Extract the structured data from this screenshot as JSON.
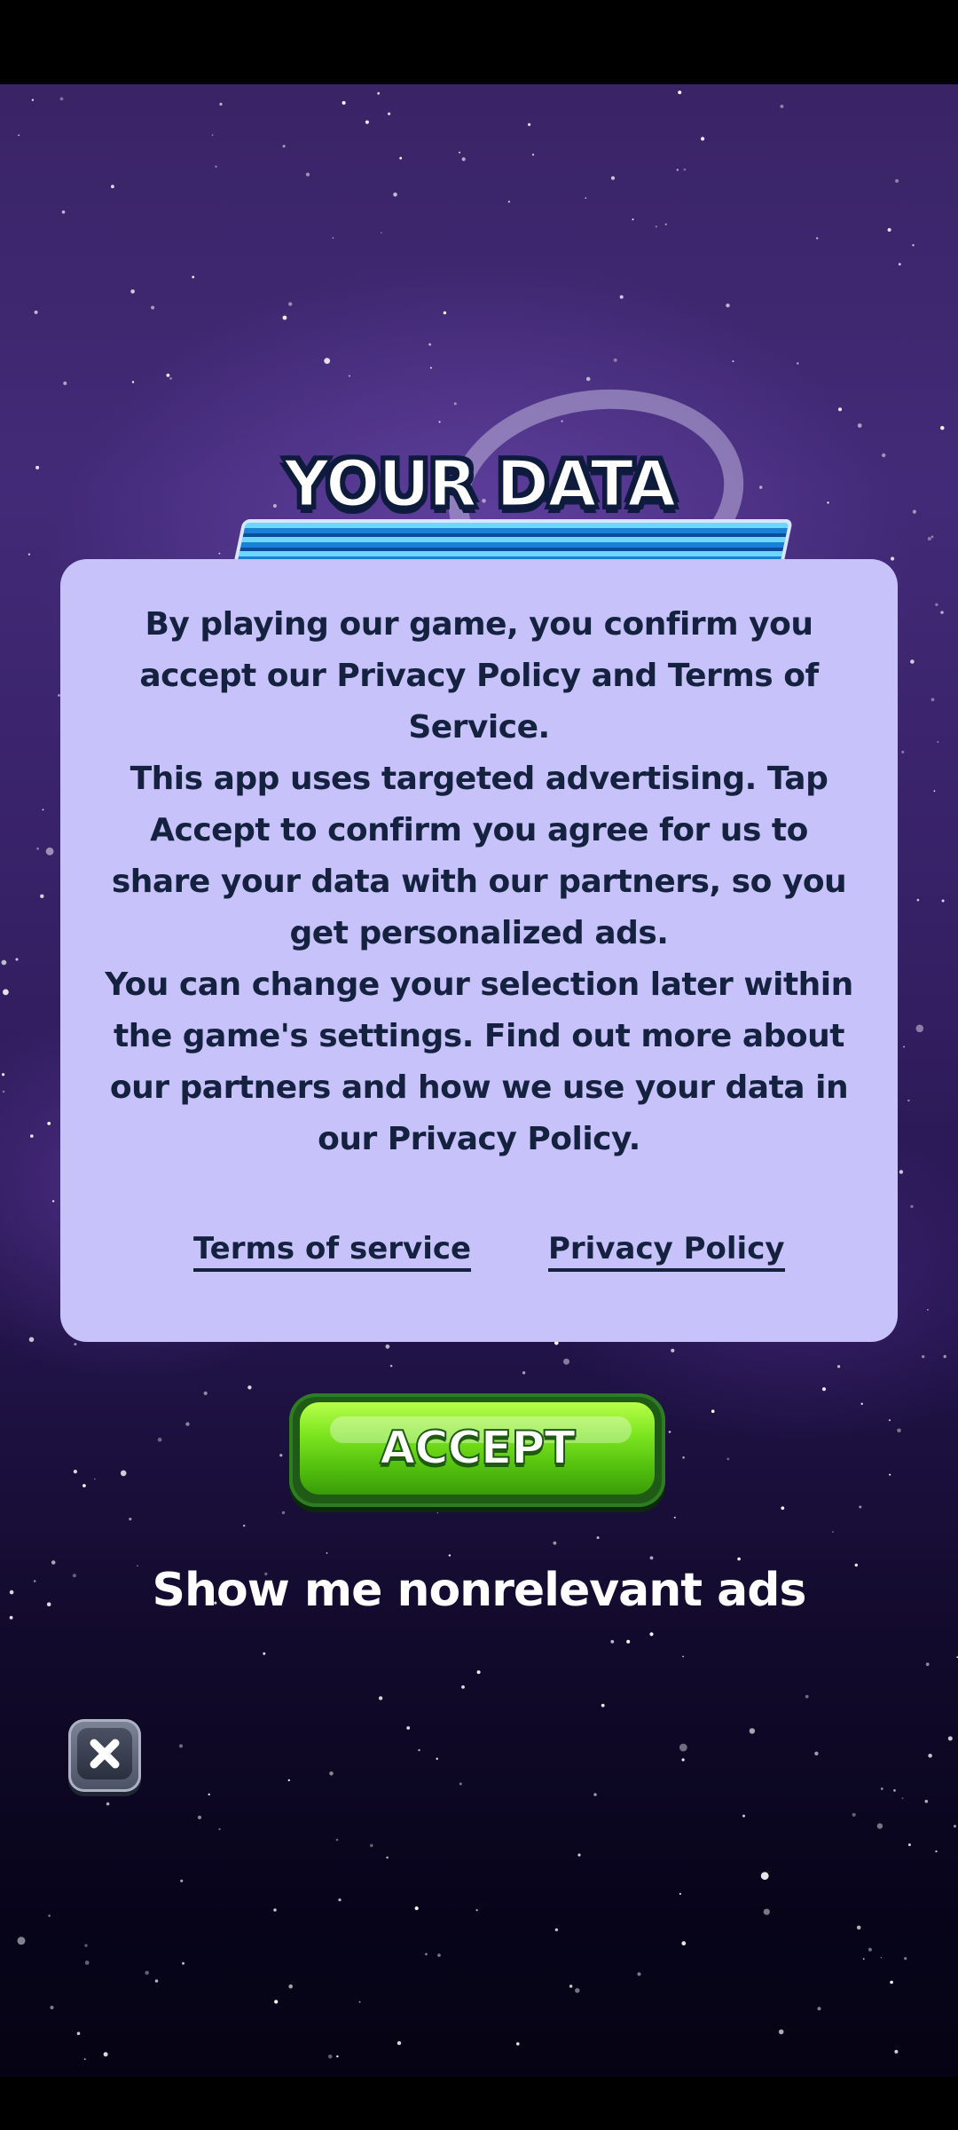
{
  "title": "YOUR DATA",
  "consent": {
    "paragraphs": [
      "By playing our game, you confirm you accept our Privacy Policy and Terms of Service.",
      "This app uses targeted advertising. Tap Accept to confirm you agree for us to share your data with our partners, so you get personalized ads.",
      "You can change your selection later within the game's settings. Find out more about our partners and how we use your data in our Privacy Policy."
    ],
    "terms_link": "Terms of service",
    "privacy_link": "Privacy Policy"
  },
  "accept_label": "ACCEPT",
  "nonrelevant_label": "Show me nonrelevant ads",
  "icons": {
    "close": "close-icon",
    "logo_ring": "logo-ring-icon"
  },
  "colors": {
    "panel": "#c7c2fa",
    "panel_text": "#14213f",
    "accept_green": "#7de51f",
    "background": "#3a2466"
  }
}
